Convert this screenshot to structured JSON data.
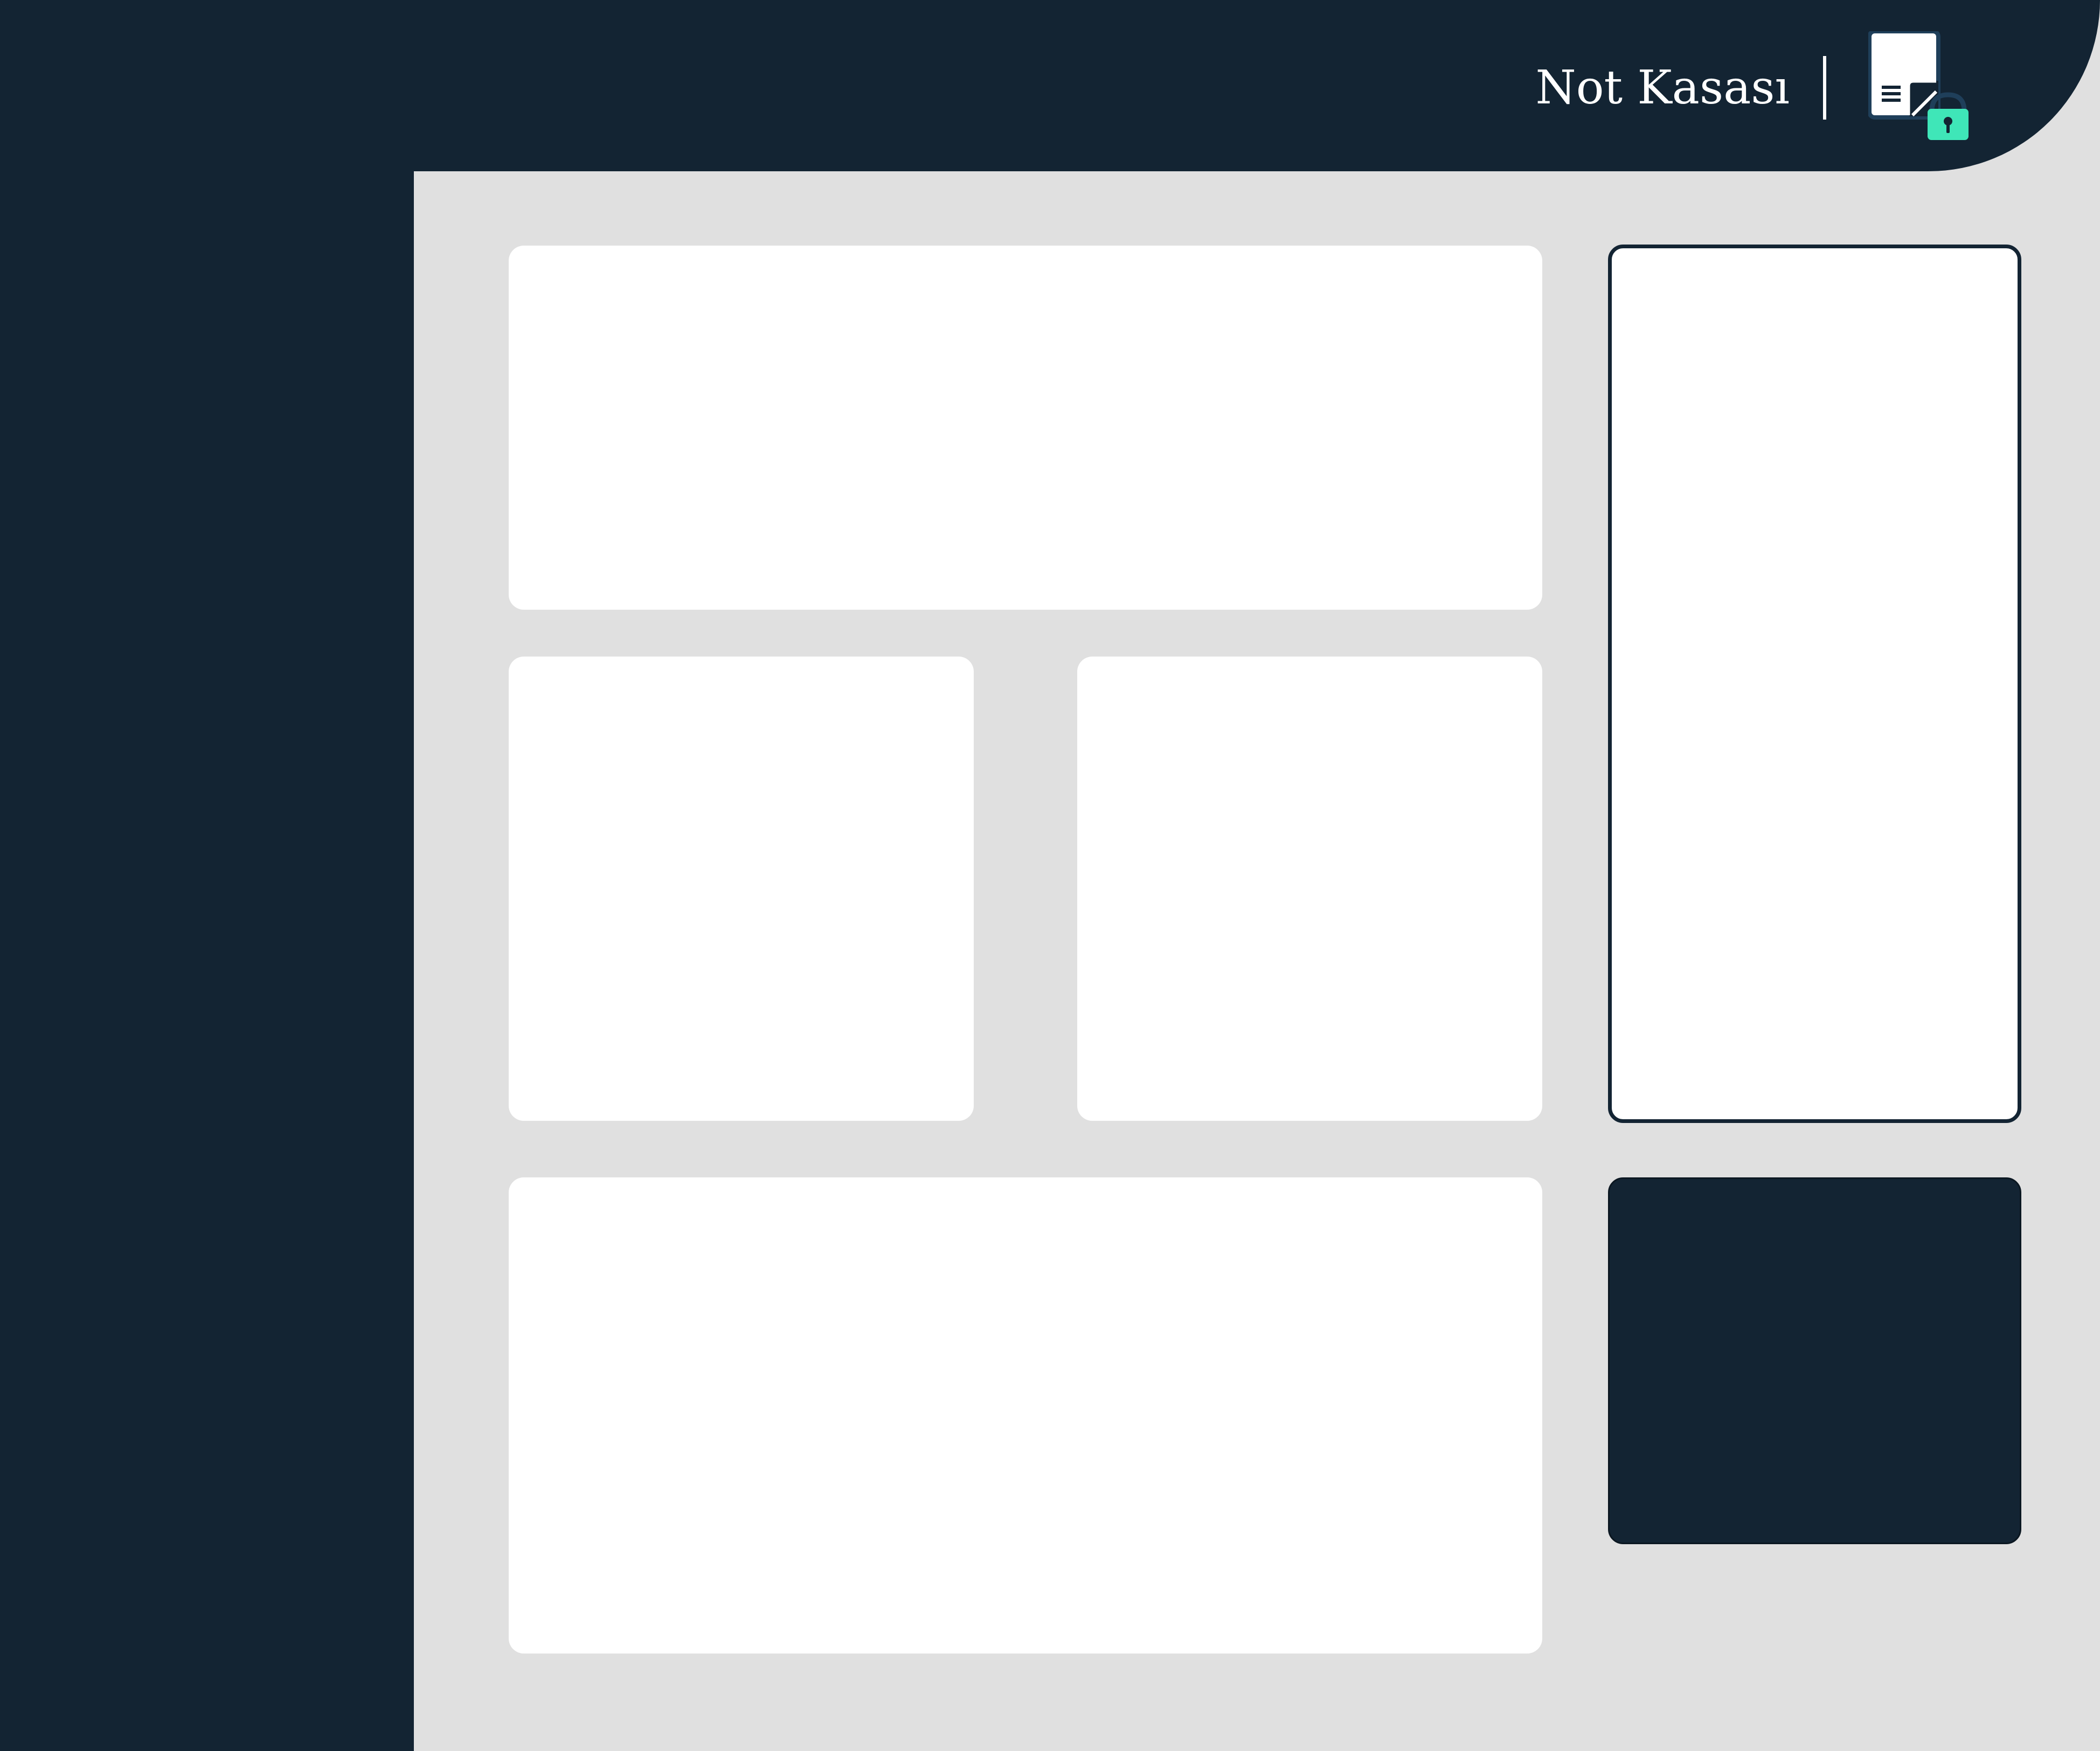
{
  "app": {
    "title": "Not Kasası"
  },
  "header": {
    "logo_icon": "note-lock-icon"
  },
  "colors": {
    "primary_dark": "#132433",
    "content_background": "#e0e0e0",
    "card_background": "#ffffff",
    "accent": "#3fe6b8"
  }
}
